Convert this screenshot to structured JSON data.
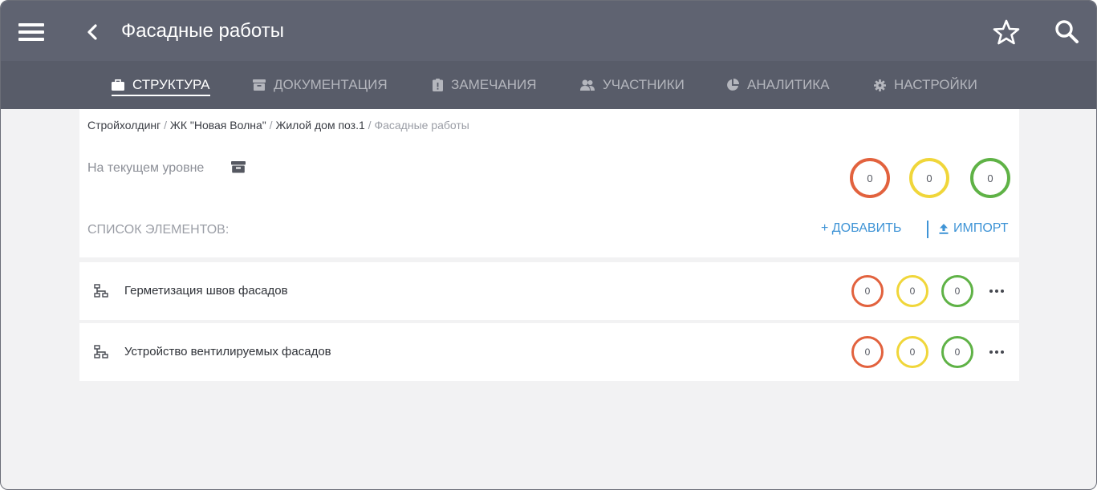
{
  "header": {
    "title": "Фасадные работы",
    "menu_icon": "hamburger-menu-icon",
    "back_icon": "chevron-left-icon",
    "favorite_icon": "star-outline-icon",
    "search_icon": "search-icon"
  },
  "tabs": [
    {
      "label": "СТРУКТУРА",
      "icon": "briefcase-icon",
      "active": true
    },
    {
      "label": "ДОКУМЕНТАЦИЯ",
      "icon": "archive-icon",
      "active": false
    },
    {
      "label": "ЗАМЕЧАНИЯ",
      "icon": "clipboard-alert-icon",
      "active": false
    },
    {
      "label": "УЧАСТНИКИ",
      "icon": "users-icon",
      "active": false
    },
    {
      "label": "АНАЛИТИКА",
      "icon": "pie-chart-icon",
      "active": false
    },
    {
      "label": "НАСТРОЙКИ",
      "icon": "gear-icon",
      "active": false
    }
  ],
  "breadcrumb": {
    "items": [
      "Стройхолдинг",
      "ЖК \"Новая Волна\"",
      "Жилой дом поз.1"
    ],
    "separator": "/",
    "current": "Фасадные работы"
  },
  "current_level": {
    "label": "На текущем уровне",
    "icon": "archive-icon",
    "counts": [
      "0",
      "0",
      "0"
    ]
  },
  "list": {
    "title": "СПИСОК ЭЛЕМЕНТОВ:",
    "add_label": "+ ДОБАВИТЬ",
    "import_label": "ИМПОРТ",
    "import_icon": "upload-icon",
    "items": [
      {
        "label": "Герметизация швов фасадов",
        "icon": "hierarchy-icon",
        "counts": [
          "0",
          "0",
          "0"
        ],
        "more_icon": "more-horizontal-icon"
      },
      {
        "label": "Устройство вентилируемых фасадов",
        "icon": "hierarchy-icon",
        "counts": [
          "0",
          "0",
          "0"
        ],
        "more_icon": "more-horizontal-icon"
      }
    ]
  },
  "colors": {
    "topbar": "#5f6371",
    "tabbar": "#585c69",
    "accent": "#3f94d6",
    "status_red": "#e2623e",
    "status_yellow": "#f0d63a",
    "status_green": "#5fb246"
  }
}
